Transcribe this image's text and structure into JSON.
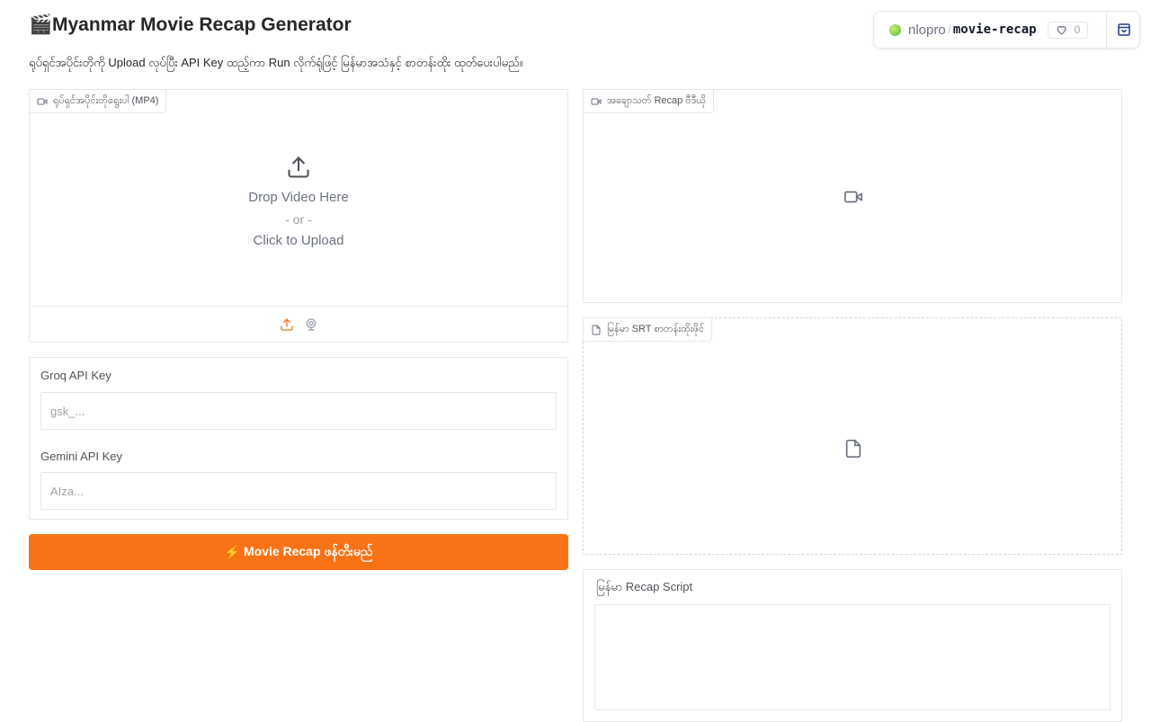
{
  "header": {
    "emoji": "🎬",
    "title": "Myanmar Movie Recap Generator",
    "subtitle": "ရုပ်ရှင်အပိုင်းတိုကို Upload လုပ်ပြီး API Key ထည့်ကာ Run လိုက်ရုံဖြင့် မြန်မာအသံနှင့် စာတန်းထိုး ထုတ်ပေးပါမည်။"
  },
  "hf_badge": {
    "owner": "nlopro",
    "separator": "/",
    "repo": "movie-recap",
    "likes": "0"
  },
  "upload": {
    "label": "ရုပ်ရှင်အပိုင်းတိုရွေးပါ (MP4)",
    "drop_text": "Drop Video Here",
    "or_text": "- or -",
    "click_text": "Click to Upload"
  },
  "api_keys": {
    "groq_label": "Groq API Key",
    "groq_placeholder": "gsk_...",
    "groq_value": "",
    "gemini_label": "Gemini API Key",
    "gemini_placeholder": "AIza...",
    "gemini_value": ""
  },
  "run_button": {
    "icon": "⚡",
    "label": "Movie Recap ဖန်တီးမည်"
  },
  "output_video": {
    "label": "အချောသတ် Recap ဗီဒီယို"
  },
  "srt_file": {
    "label": "မြန်မာ SRT စာတန်းထိုးဖိုင်"
  },
  "script_box": {
    "label": "မြန်မာ Recap Script",
    "value": ""
  },
  "colors": {
    "accent": "#f97316",
    "border": "#e5e7eb"
  }
}
